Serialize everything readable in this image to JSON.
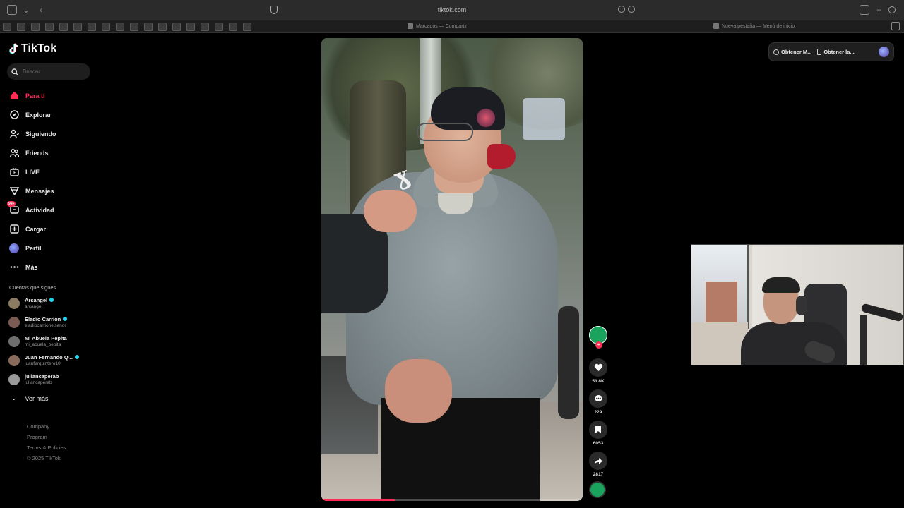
{
  "browser": {
    "url": "tiktok.com",
    "tab_center": "Marcados — Compartir",
    "tab_right": "Nueva pestaña — Menú de inicio"
  },
  "sidebar": {
    "logo": "TikTok",
    "search_placeholder": "Buscar",
    "nav": [
      {
        "label": "Para ti",
        "icon": "home-icon",
        "active": true
      },
      {
        "label": "Explorar",
        "icon": "compass-icon",
        "active": false
      },
      {
        "label": "Siguiendo",
        "icon": "following-icon",
        "active": false
      },
      {
        "label": "Friends",
        "icon": "friends-icon",
        "active": false
      },
      {
        "label": "LIVE",
        "icon": "live-icon",
        "active": false
      },
      {
        "label": "Mensajes",
        "icon": "messages-icon",
        "active": false
      },
      {
        "label": "Actividad",
        "icon": "activity-icon",
        "active": false,
        "badge": "99+"
      },
      {
        "label": "Cargar",
        "icon": "upload-icon",
        "active": false
      },
      {
        "label": "Perfil",
        "icon": "profile-avatar",
        "active": false
      },
      {
        "label": "Más",
        "icon": "more-icon",
        "active": false
      }
    ],
    "following_title": "Cuentas que sigues",
    "following": [
      {
        "name": "Arcangel",
        "user": "arcangel",
        "verified": true
      },
      {
        "name": "Eladio Carrión",
        "user": "eladiocarrionelsenor",
        "verified": true
      },
      {
        "name": "Mi Abuela Pepita",
        "user": "mi_abuela_pepita",
        "verified": false
      },
      {
        "name": "Juan Fernando Q...",
        "user": "juanferquintero10",
        "verified": true
      },
      {
        "name": "juliancaperab",
        "user": "juliancaperab",
        "verified": false
      }
    ],
    "see_more": "Ver más",
    "footer": [
      "Company",
      "Program",
      "Terms & Policies",
      "© 2025 TikTok"
    ]
  },
  "video": {
    "progress": 0.28
  },
  "actions": {
    "likes": "53.8K",
    "comments": "229",
    "saves": "6053",
    "shares": "2817"
  },
  "extension": {
    "item1": "Obtener M...",
    "item2": "Obtener la..."
  },
  "colors": {
    "accent": "#fe2c55",
    "background": "#000000",
    "verified": "#20d5ec"
  }
}
